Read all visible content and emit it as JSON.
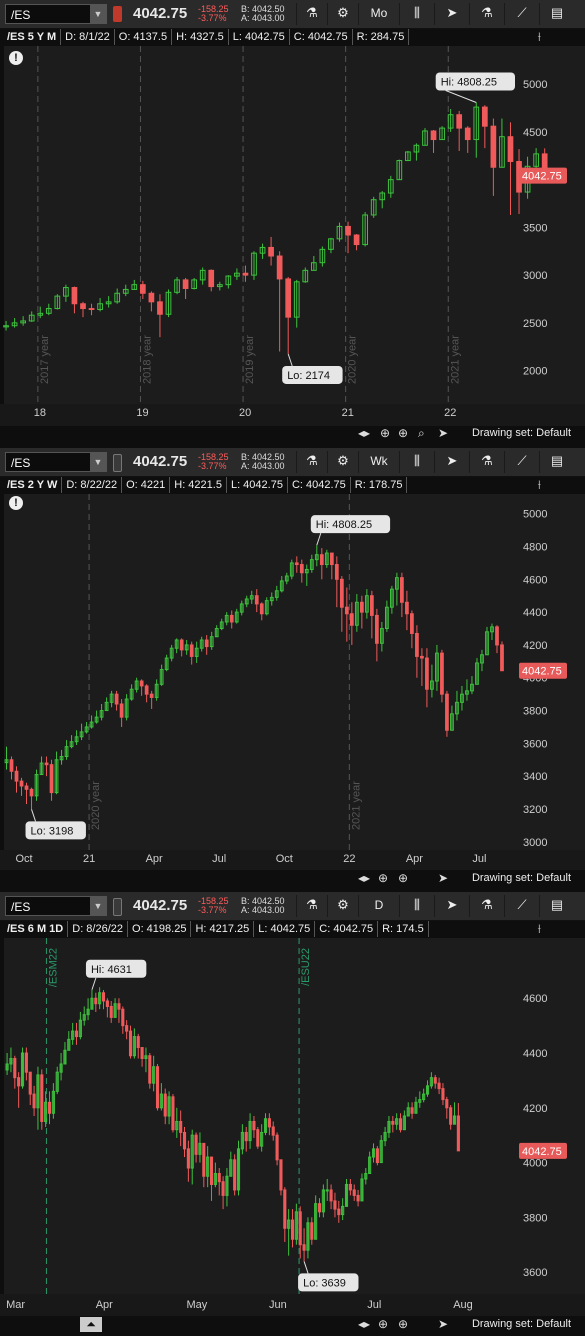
{
  "colors": {
    "up": "#3ec23e",
    "down": "#f05a5a",
    "price_tag": "#e85a5a",
    "bg": "#1c1c1c",
    "grid_line": "#3a3a3a",
    "toolbar": "#2a2a2a"
  },
  "panels": [
    {
      "symbol": "/ES",
      "last_price": "4042.75",
      "change": "-158.25",
      "change_pct": "-3.77%",
      "bid": "B: 4042.50",
      "ask": "A: 4043.00",
      "aggregation": "Mo",
      "header": {
        "title": "/ES 5 Y M",
        "date": "D: 8/1/22",
        "open": "O: 4137.5",
        "high": "H: 4327.5",
        "low": "L: 4042.75",
        "close": "C: 4042.75",
        "range": "R: 284.75"
      },
      "footer_drawing_set": "Drawing set: Default"
    },
    {
      "symbol": "/ES",
      "last_price": "4042.75",
      "change": "-158.25",
      "change_pct": "-3.77%",
      "bid": "B: 4042.50",
      "ask": "A: 4043.00",
      "aggregation": "Wk",
      "header": {
        "title": "/ES 2 Y W",
        "date": "D: 8/22/22",
        "open": "O: 4221",
        "high": "H: 4221.5",
        "low": "L: 4042.75",
        "close": "C: 4042.75",
        "range": "R: 178.75"
      },
      "footer_drawing_set": "Drawing set: Default"
    },
    {
      "symbol": "/ES",
      "last_price": "4042.75",
      "change": "-158.25",
      "change_pct": "-3.77%",
      "bid": "B: 4042.50",
      "ask": "A: 4043.00",
      "aggregation": "D",
      "header": {
        "title": "/ES 6 M 1D",
        "date": "D: 8/26/22",
        "open": "O: 4198.25",
        "high": "H: 4217.25",
        "low": "L: 4042.75",
        "close": "C: 4042.75",
        "range": "R: 174.5"
      },
      "footer_drawing_set": "Drawing set: Default"
    }
  ],
  "chart_data": [
    {
      "type": "candlestick",
      "title": "/ES 5 Y M",
      "ylim": [
        1650,
        5400
      ],
      "y_ticks": [
        "2000",
        "2500",
        "3000",
        "3500",
        "4000",
        "4500",
        "5000"
      ],
      "x_ticks": [
        "18",
        "19",
        "20",
        "21",
        "22"
      ],
      "x_tick_pos": [
        0.0,
        1.0,
        2.0,
        3.0,
        4.0
      ],
      "x_range": [
        -0.35,
        4.65
      ],
      "year_lines": [
        {
          "x": -0.02,
          "label": "2017 year"
        },
        {
          "x": 0.98,
          "label": "2018 year"
        },
        {
          "x": 1.98,
          "label": "2019 year"
        },
        {
          "x": 2.98,
          "label": "2020 year"
        },
        {
          "x": 3.98,
          "label": "2021 year"
        }
      ],
      "series_start": -0.33,
      "series_step": 0.08333,
      "closes": [
        2470,
        2500,
        2520,
        2580,
        2600,
        2650,
        2780,
        2870,
        2700,
        2650,
        2640,
        2700,
        2720,
        2810,
        2850,
        2900,
        2810,
        2720,
        2590,
        2820,
        2950,
        2860,
        2950,
        3050,
        2880,
        2900,
        2990,
        3020,
        3000,
        3230,
        3290,
        3200,
        2960,
        2560,
        2930,
        3050,
        3130,
        3270,
        3380,
        3510,
        3420,
        3320,
        3630,
        3790,
        3860,
        4000,
        4200,
        4290,
        4360,
        4510,
        4420,
        4540,
        4680,
        4540,
        4420,
        4760,
        4560,
        4130,
        4450,
        4190,
        3870,
        4140,
        4270,
        4042.75
      ],
      "highs": [
        2520,
        2550,
        2570,
        2620,
        2670,
        2700,
        2800,
        2900,
        2880,
        2720,
        2700,
        2760,
        2780,
        2860,
        2900,
        2950,
        2940,
        2830,
        2800,
        2850,
        2980,
        2970,
        2970,
        3080,
        3060,
        2930,
        3000,
        3070,
        3100,
        3250,
        3330,
        3400,
        3250,
        2980,
        2950,
        3080,
        3200,
        3300,
        3390,
        3550,
        3560,
        3430,
        3660,
        3820,
        3880,
        4040,
        4210,
        4300,
        4380,
        4540,
        4520,
        4560,
        4740,
        4720,
        4560,
        4808.25,
        4780,
        4640,
        4640,
        4600,
        4320,
        4240,
        4330,
        4327.5
      ],
      "lows": [
        2420,
        2450,
        2470,
        2510,
        2550,
        2580,
        2640,
        2720,
        2600,
        2560,
        2580,
        2620,
        2660,
        2700,
        2780,
        2850,
        2750,
        2620,
        2350,
        2560,
        2800,
        2750,
        2850,
        2900,
        2830,
        2840,
        2860,
        2950,
        2930,
        2950,
        3170,
        3100,
        2200,
        2174,
        2450,
        2920,
        3050,
        3090,
        3230,
        3350,
        3230,
        3260,
        3300,
        3600,
        3700,
        3810,
        4000,
        4200,
        4200,
        4360,
        4280,
        4420,
        4500,
        4300,
        4280,
        4230,
        4330,
        3830,
        4150,
        3630,
        3640,
        3800,
        4060,
        4042.75
      ],
      "last_tag": "4042.75",
      "hi_label": "Hi: 4808.25",
      "hi_idx": 55,
      "lo_label": "Lo: 2174",
      "lo_idx": 33
    },
    {
      "type": "candlestick",
      "title": "/ES 2 Y W",
      "ylim": [
        2950,
        5120
      ],
      "y_ticks": [
        "3000",
        "3200",
        "3400",
        "3600",
        "3800",
        "4000",
        "4200",
        "4400",
        "4600",
        "4800",
        "5000"
      ],
      "x_ticks": [
        "Oct",
        "21",
        "Apr",
        "Jul",
        "Oct",
        "22",
        "Apr",
        "Jul"
      ],
      "x_tick_pos": [
        4,
        17,
        30,
        43,
        56,
        69,
        82,
        95
      ],
      "x_range": [
        0,
        102.5
      ],
      "year_lines": [
        {
          "x": 17.0,
          "label": "2020 year"
        },
        {
          "x": 69.0,
          "label": "2021 year"
        }
      ],
      "series_start": 0.5,
      "series_step": 1.0,
      "closes": [
        3500,
        3430,
        3370,
        3340,
        3320,
        3280,
        3410,
        3480,
        3470,
        3300,
        3500,
        3520,
        3580,
        3610,
        3640,
        3670,
        3700,
        3730,
        3760,
        3800,
        3850,
        3900,
        3840,
        3760,
        3870,
        3930,
        3980,
        3950,
        3900,
        3880,
        3960,
        4050,
        4120,
        4180,
        4230,
        4170,
        4200,
        4130,
        4180,
        4230,
        4190,
        4250,
        4300,
        4340,
        4380,
        4340,
        4400,
        4450,
        4480,
        4500,
        4450,
        4390,
        4470,
        4490,
        4530,
        4590,
        4620,
        4700,
        4690,
        4640,
        4660,
        4720,
        4750,
        4690,
        4760,
        4690,
        4600,
        4430,
        4390,
        4320,
        4460,
        4400,
        4500,
        4380,
        4210,
        4300,
        4430,
        4540,
        4610,
        4460,
        4390,
        4270,
        4130,
        4120,
        3930,
        3980,
        4150,
        3900,
        3680,
        3780,
        3850,
        3900,
        3920,
        3960,
        4090,
        4140,
        4280,
        4310,
        4200,
        4042.75
      ],
      "highs": [
        3580,
        3520,
        3460,
        3390,
        3360,
        3330,
        3440,
        3520,
        3520,
        3500,
        3550,
        3560,
        3620,
        3650,
        3680,
        3720,
        3730,
        3770,
        3800,
        3840,
        3880,
        3920,
        3920,
        3870,
        3900,
        3960,
        4000,
        3990,
        3960,
        3920,
        3990,
        4080,
        4140,
        4200,
        4240,
        4240,
        4230,
        4220,
        4220,
        4250,
        4260,
        4280,
        4320,
        4360,
        4400,
        4410,
        4420,
        4470,
        4500,
        4530,
        4540,
        4460,
        4490,
        4520,
        4560,
        4620,
        4640,
        4720,
        4740,
        4720,
        4690,
        4750,
        4808.25,
        4790,
        4780,
        4760,
        4740,
        4620,
        4550,
        4460,
        4510,
        4500,
        4540,
        4530,
        4420,
        4340,
        4470,
        4560,
        4640,
        4640,
        4530,
        4410,
        4320,
        4180,
        4180,
        4080,
        4200,
        4170,
        3920,
        3830,
        3920,
        3950,
        3990,
        4010,
        4120,
        4170,
        4310,
        4330,
        4320,
        4221.5
      ],
      "lows": [
        3440,
        3380,
        3300,
        3280,
        3230,
        3198,
        3250,
        3420,
        3400,
        3250,
        3290,
        3470,
        3500,
        3570,
        3590,
        3620,
        3660,
        3690,
        3720,
        3740,
        3800,
        3820,
        3800,
        3700,
        3740,
        3860,
        3910,
        3890,
        3850,
        3810,
        3860,
        3950,
        4040,
        4100,
        4150,
        4130,
        4140,
        4080,
        4090,
        4160,
        4140,
        4170,
        4250,
        4290,
        4320,
        4300,
        4330,
        4380,
        4430,
        4450,
        4400,
        4350,
        4380,
        4440,
        4470,
        4520,
        4570,
        4600,
        4640,
        4580,
        4560,
        4640,
        4680,
        4600,
        4670,
        4600,
        4430,
        4280,
        4220,
        4200,
        4280,
        4300,
        4360,
        4240,
        4100,
        4160,
        4280,
        4390,
        4440,
        4370,
        4290,
        4180,
        4000,
        3950,
        3820,
        3880,
        3920,
        3850,
        3640,
        3680,
        3740,
        3800,
        3860,
        3900,
        3960,
        4040,
        4140,
        4230,
        4150,
        4042.75
      ],
      "last_tag": "4042.75",
      "hi_label": "Hi: 4808.25",
      "hi_idx": 62,
      "lo_label": "Lo: 3198",
      "lo_idx": 5
    },
    {
      "type": "candlestick",
      "title": "/ES 6 M 1D",
      "ylim": [
        3520,
        4820
      ],
      "y_ticks": [
        "3600",
        "3800",
        "4000",
        "4200",
        "4400",
        "4600"
      ],
      "x_ticks": [
        "Mar",
        "Apr",
        "May",
        "Jun",
        "Jul",
        "Aug"
      ],
      "x_tick_pos": [
        3,
        26,
        50,
        71,
        96,
        119
      ],
      "x_range": [
        0,
        133
      ],
      "year_lines": [
        {
          "x": 11.0,
          "label": "/ESM22"
        },
        {
          "x": 76.5,
          "label": "/ESU22"
        }
      ],
      "series_start": 0.8,
      "series_step": 1.0,
      "closes": [
        4360,
        4380,
        4310,
        4280,
        4400,
        4330,
        4250,
        4200,
        4320,
        4150,
        4220,
        4180,
        4260,
        4330,
        4360,
        4410,
        4450,
        4480,
        4460,
        4520,
        4540,
        4560,
        4600,
        4580,
        4620,
        4590,
        4570,
        4530,
        4580,
        4560,
        4500,
        4480,
        4390,
        4460,
        4420,
        4380,
        4390,
        4290,
        4350,
        4200,
        4250,
        4170,
        4240,
        4120,
        4150,
        4110,
        4050,
        3980,
        4100,
        4030,
        4070,
        3950,
        4020,
        3920,
        3960,
        3930,
        3880,
        3950,
        4010,
        3900,
        4050,
        4110,
        4080,
        4150,
        4120,
        4060,
        4110,
        4160,
        4130,
        4100,
        4010,
        3900,
        3760,
        3790,
        3720,
        3820,
        3700,
        3680,
        3780,
        3720,
        3850,
        3820,
        3900,
        3900,
        3860,
        3830,
        3810,
        3840,
        3920,
        3900,
        3880,
        3860,
        3940,
        3960,
        4020,
        4050,
        4000,
        4080,
        4110,
        4150,
        4140,
        4160,
        4120,
        4170,
        4200,
        4180,
        4220,
        4230,
        4250,
        4280,
        4310,
        4290,
        4270,
        4230,
        4200,
        4140,
        4170,
        4042.75
      ],
      "highs": [
        4400,
        4420,
        4390,
        4330,
        4420,
        4420,
        4310,
        4280,
        4350,
        4340,
        4260,
        4260,
        4290,
        4350,
        4400,
        4440,
        4480,
        4510,
        4510,
        4550,
        4570,
        4600,
        4631,
        4620,
        4640,
        4630,
        4600,
        4590,
        4600,
        4600,
        4570,
        4520,
        4500,
        4490,
        4470,
        4420,
        4420,
        4400,
        4390,
        4360,
        4290,
        4270,
        4260,
        4250,
        4200,
        4190,
        4130,
        4080,
        4120,
        4110,
        4110,
        4060,
        4060,
        4020,
        4000,
        3980,
        3950,
        3980,
        4040,
        4030,
        4080,
        4140,
        4130,
        4180,
        4170,
        4130,
        4140,
        4180,
        4180,
        4150,
        4110,
        4010,
        3910,
        3830,
        3830,
        3850,
        3840,
        3760,
        3800,
        3800,
        3880,
        3870,
        3920,
        3940,
        3920,
        3890,
        3860,
        3870,
        3940,
        3940,
        3920,
        3900,
        3960,
        3980,
        4040,
        4070,
        4060,
        4100,
        4130,
        4170,
        4170,
        4180,
        4180,
        4190,
        4220,
        4220,
        4240,
        4260,
        4270,
        4300,
        4330,
        4320,
        4310,
        4290,
        4240,
        4210,
        4220,
        4217.25
      ],
      "lows": [
        4320,
        4330,
        4270,
        4200,
        4270,
        4300,
        4210,
        4170,
        4120,
        4120,
        4130,
        4140,
        4160,
        4250,
        4300,
        4360,
        4410,
        4430,
        4430,
        4450,
        4500,
        4520,
        4560,
        4550,
        4560,
        4560,
        4530,
        4510,
        4530,
        4510,
        4470,
        4450,
        4380,
        4380,
        4380,
        4350,
        4330,
        4270,
        4260,
        4190,
        4190,
        4140,
        4140,
        4110,
        4090,
        4060,
        4020,
        3930,
        3920,
        4000,
        4000,
        3910,
        3910,
        3860,
        3910,
        3880,
        3830,
        3840,
        3950,
        3880,
        3880,
        4030,
        4040,
        4050,
        4090,
        4050,
        4040,
        4100,
        4100,
        4080,
        3990,
        3880,
        3710,
        3660,
        3690,
        3700,
        3650,
        3639,
        3650,
        3700,
        3720,
        3800,
        3800,
        3860,
        3830,
        3800,
        3780,
        3790,
        3840,
        3880,
        3860,
        3840,
        3860,
        3920,
        3960,
        4000,
        3990,
        4020,
        4060,
        4090,
        4110,
        4120,
        4110,
        4120,
        4170,
        4160,
        4180,
        4200,
        4220,
        4240,
        4270,
        4270,
        4250,
        4210,
        4160,
        4120,
        4140,
        4042.75
      ],
      "last_tag": "4042.75",
      "hi_label": "Hi: 4631",
      "hi_idx": 22,
      "lo_label": "Lo: 3639",
      "lo_idx": 77
    }
  ]
}
